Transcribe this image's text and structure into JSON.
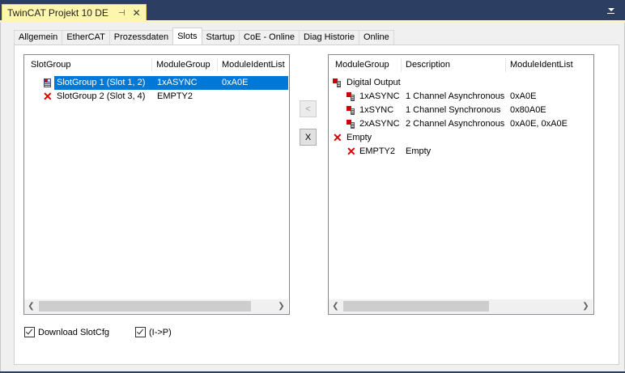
{
  "document_tab": {
    "title": "TwinCAT Projekt 10 DE",
    "pin_glyph": "⊣",
    "close_glyph": "✕"
  },
  "tabs": [
    "Allgemein",
    "EtherCAT",
    "Prozessdaten",
    "Slots",
    "Startup",
    "CoE - Online",
    "Diag Historie",
    "Online"
  ],
  "active_tab": "Slots",
  "slots_list": {
    "columns": [
      "SlotGroup",
      "ModuleGroup",
      "ModuleIdentList"
    ],
    "rows": [
      {
        "slotgroup": "SlotGroup 1 (Slot 1, 2)",
        "modulegroup": "1xASYNC",
        "identlist": "0xA0E",
        "selected": true,
        "icon": "module-icon"
      },
      {
        "slotgroup": "SlotGroup 2 (Slot 3, 4)",
        "modulegroup": "EMPTY2",
        "identlist": "",
        "selected": false,
        "icon": "red-x-icon"
      }
    ]
  },
  "buttons": {
    "insert": "<",
    "delete": "X"
  },
  "module_list": {
    "columns": [
      "ModuleGroup",
      "Description",
      "ModuleIdentList"
    ],
    "groups": [
      {
        "name": "Digital Output",
        "icon": "module-group-icon",
        "items": [
          {
            "name": "1xASYNC",
            "description": "1 Channel Asynchronous",
            "identlist": "0xA0E"
          },
          {
            "name": "1xSYNC",
            "description": "1 Channel Synchronous",
            "identlist": "0x80A0E"
          },
          {
            "name": "2xASYNC",
            "description": "2 Channel Asynchronous",
            "identlist": "0xA0E, 0xA0E"
          }
        ]
      },
      {
        "name": "Empty",
        "icon": "red-x-icon",
        "items": [
          {
            "name": "EMPTY2",
            "description": "Empty",
            "identlist": ""
          }
        ]
      }
    ]
  },
  "checkboxes": [
    {
      "label": "Download SlotCfg",
      "checked": true
    },
    {
      "label": "(I->P)",
      "checked": true
    }
  ],
  "colors": {
    "title_bar": "#2c3f63",
    "doc_tab": "#fff6ad",
    "selection": "#0078d7",
    "error_red": "#d40000"
  }
}
